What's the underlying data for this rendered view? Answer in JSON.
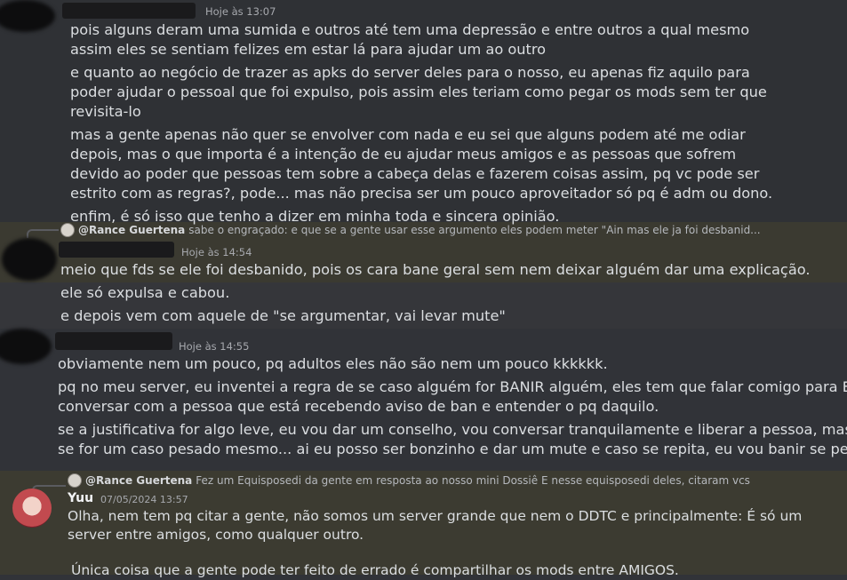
{
  "messages": [
    {
      "timestamp": "Hoje às 13:07",
      "lines": [
        "pois alguns deram uma sumida e outros até tem uma depressão e entre outros a qual mesmo",
        "assim eles se sentiam felizes em estar lá para ajudar um ao outro",
        "e quanto ao negócio de trazer as apks do server deles para o nosso, eu apenas fiz aquilo para",
        "poder ajudar o pessoal que foi expulso, pois assim eles teriam como pegar os mods sem ter que",
        "revisita-lo",
        "mas a gente apenas não quer se envolver com nada e eu sei que alguns podem até me odiar",
        "depois, mas o que importa é a intenção de eu ajudar meus amigos e as pessoas que sofrem",
        "devido ao poder que pessoas tem sobre a cabeça delas e fazerem coisas assim, pq vc pode ser",
        "estrito com as regras?, pode... mas não precisa ser um pouco aproveitador só pq é adm ou dono.",
        "enfim, é só isso que tenho a dizer em minha toda e sincera opinião."
      ]
    },
    {
      "reply_to": "@Rance Guertena",
      "reply_text": "sabe o engraçado: e que se a gente usar esse argumento eles podem meter \"Ain mas ele ja foi desbanid...",
      "timestamp": "Hoje às 14:54",
      "lines": [
        "meio que fds se ele foi desbanido, pois os cara bane geral sem nem deixar alguém dar uma explicação.",
        "ele só expulsa e cabou.",
        "e depois vem com aquele de \"se argumentar, vai levar mute\""
      ]
    },
    {
      "timestamp": "Hoje às 14:55",
      "lines": [
        "obviamente nem um pouco, pq adultos eles não são nem um pouco kkkkkk.",
        "pq no meu server, eu inventei a regra de se caso alguém for BANIR alguém, eles tem que falar comigo para EU",
        "conversar com a pessoa que está recebendo aviso de ban e entender o pq daquilo.",
        "se a justificativa for algo leve, eu vou dar um conselho, vou conversar tranquilamente e liberar a pessoa, mas",
        "se for um caso pesado mesmo... ai eu posso ser bonzinho e dar um mute e caso se repita, eu vou banir se pedir."
      ]
    },
    {
      "reply_to": "@Rance Guertena",
      "reply_text": "Fez um Equisposedi da gente em resposta ao nosso mini Dossiê   E nesse equisposedi deles, citaram vcs",
      "author": "Yuu",
      "timestamp": "07/05/2024 13:57",
      "lines": [
        "Olha, nem tem pq citar a gente, não somos um server grande que nem o DDTC e principalmente: É só um",
        "server entre amigos, como qualquer outro.",
        "",
        "Única coisa que a gente pode ter feito de errado é compartilhar os mods entre AMIGOS."
      ]
    }
  ]
}
